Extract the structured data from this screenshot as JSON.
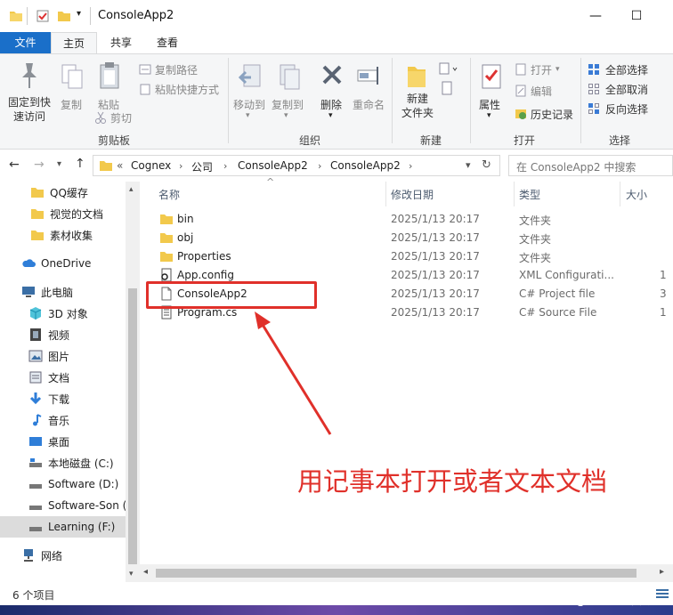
{
  "window": {
    "title": "ConsoleApp2",
    "minimize_glyph": "—",
    "maximize_glyph": "☐"
  },
  "ribbon_tabs": [
    {
      "label": "文件"
    },
    {
      "label": "主页"
    },
    {
      "label": "共享"
    },
    {
      "label": "查看"
    }
  ],
  "ribbon": {
    "clipboard": {
      "label": "剪贴板",
      "pin": "固定到快\n速访问",
      "copy": "复制",
      "paste": "粘贴",
      "copy_path": "复制路径",
      "paste_shortcut": "粘贴快捷方式",
      "cut": "剪切"
    },
    "organize": {
      "label": "组织",
      "move_to": "移动到",
      "copy_to": "复制到",
      "delete": "删除",
      "rename": "重命名"
    },
    "new": {
      "label": "新建",
      "new_folder": "新建\n文件夹"
    },
    "open": {
      "label": "打开",
      "properties": "属性",
      "open": "打开",
      "edit": "编辑",
      "history": "历史记录"
    },
    "select": {
      "label": "选择",
      "select_all": "全部选择",
      "select_none": "全部取消",
      "invert": "反向选择"
    }
  },
  "address": {
    "overflow": "«",
    "crumbs": [
      "Cognex",
      "公司",
      "ConsoleApp2",
      "ConsoleApp2"
    ],
    "search_placeholder": "在 ConsoleApp2 中搜索"
  },
  "nav_pane": [
    {
      "label": "QQ缓存",
      "icon": "folder-icon"
    },
    {
      "label": "视觉的文档",
      "icon": "folder-icon"
    },
    {
      "label": "素材收集",
      "icon": "folder-icon"
    },
    {
      "label": "OneDrive",
      "icon": "cloud-icon"
    },
    {
      "label": "此电脑",
      "icon": "computer-icon"
    },
    {
      "label": "3D 对象",
      "icon": "cube-icon"
    },
    {
      "label": "视频",
      "icon": "video-icon"
    },
    {
      "label": "图片",
      "icon": "picture-icon"
    },
    {
      "label": "文档",
      "icon": "document-icon"
    },
    {
      "label": "下载",
      "icon": "download-icon"
    },
    {
      "label": "音乐",
      "icon": "music-icon"
    },
    {
      "label": "桌面",
      "icon": "desktop-icon"
    },
    {
      "label": "本地磁盘 (C:)",
      "icon": "drive-icon"
    },
    {
      "label": "Software (D:)",
      "icon": "drive-icon"
    },
    {
      "label": "Software-Son (",
      "icon": "drive-icon"
    },
    {
      "label": "Learning (F:)",
      "icon": "drive-icon"
    },
    {
      "label": "网络",
      "icon": "network-icon"
    }
  ],
  "columns": {
    "name": "名称",
    "modified": "修改日期",
    "type": "类型",
    "size": "大小"
  },
  "files": [
    {
      "name": "bin",
      "modified": "2025/1/13 20:17",
      "type": "文件夹",
      "size": "",
      "icon": "folder-icon"
    },
    {
      "name": "obj",
      "modified": "2025/1/13 20:17",
      "type": "文件夹",
      "size": "",
      "icon": "folder-icon"
    },
    {
      "name": "Properties",
      "modified": "2025/1/13 20:17",
      "type": "文件夹",
      "size": "",
      "icon": "folder-icon"
    },
    {
      "name": "App.config",
      "modified": "2025/1/13 20:17",
      "type": "XML Configurati...",
      "size": "1",
      "icon": "config-file-icon"
    },
    {
      "name": "ConsoleApp2",
      "modified": "2025/1/13 20:17",
      "type": "C# Project file",
      "size": "3",
      "icon": "file-icon"
    },
    {
      "name": "Program.cs",
      "modified": "2025/1/13 20:17",
      "type": "C# Source File",
      "size": "1",
      "icon": "cs-file-icon"
    }
  ],
  "status": {
    "item_count": "6 个项目"
  },
  "annotation": {
    "text": "用记事本打开或者文本文档",
    "color": "#e0302a"
  },
  "watermark": "CSDN @幻想趾于现实",
  "colors": {
    "accent": "#1a6fc9",
    "folder": "#f2c94c",
    "annotation": "#e0302a"
  }
}
